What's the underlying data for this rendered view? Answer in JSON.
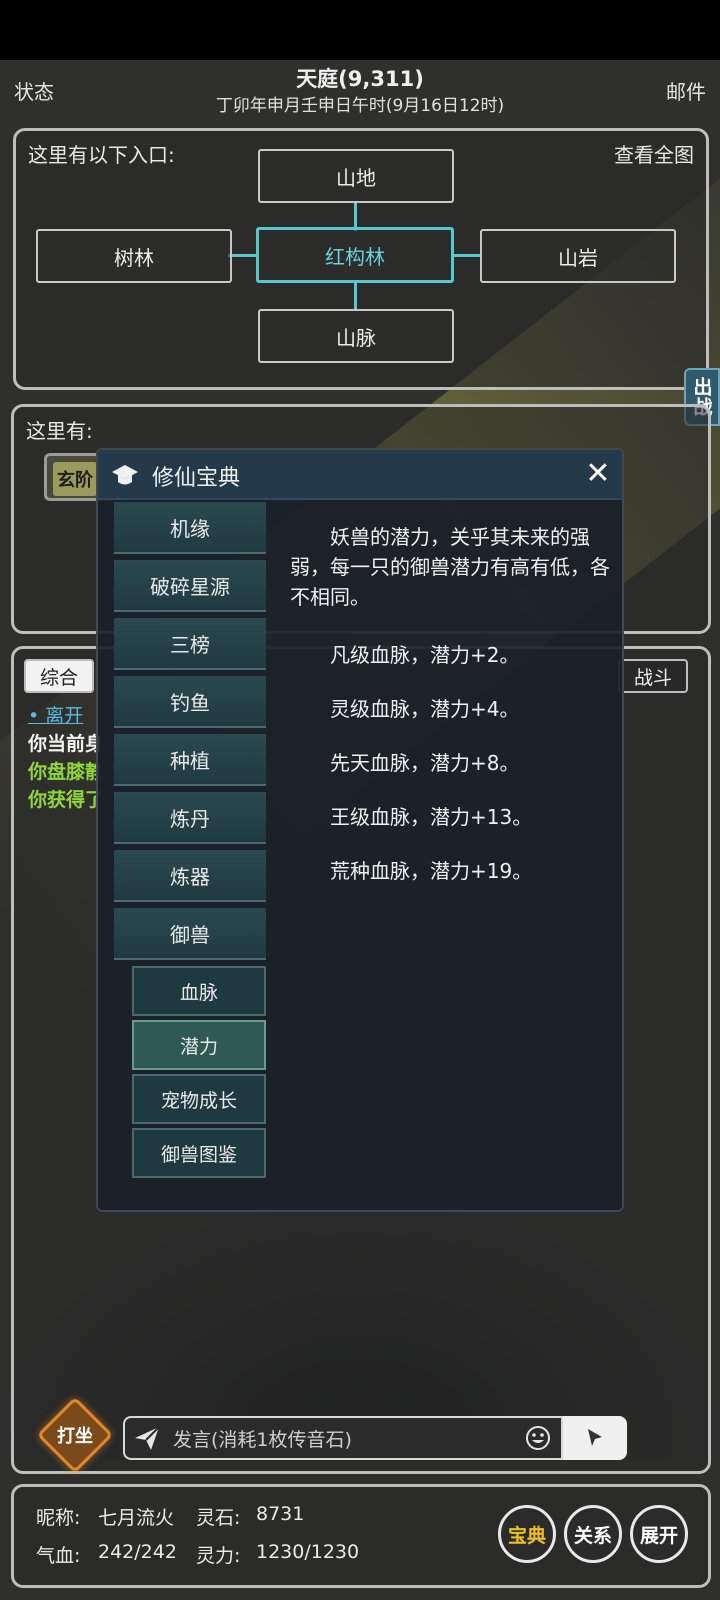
{
  "header": {
    "left": "状态",
    "title": "天庭(9,311)",
    "subtitle": "丁卯年申月壬申日午时(9月16日12时)",
    "right": "邮件"
  },
  "map": {
    "label": "这里有以下入口:",
    "view_all": "查看全图",
    "nodes": {
      "north": "山地",
      "west": "树林",
      "center": "红构林",
      "east": "山岩",
      "south": "山脉"
    }
  },
  "here": {
    "label": "这里有:",
    "npc_chip": "玄阶"
  },
  "side_tab": "出战",
  "log": {
    "tabs": {
      "general": "综合",
      "battle": "战斗"
    },
    "lines": [
      "• 离开",
      "你当前身",
      "你盘膝静",
      "你获得了"
    ]
  },
  "chat": {
    "zazen": "打坐",
    "placeholder": "发言(消耗1枚传音石)"
  },
  "player": {
    "nickname_label": "昵称:",
    "nickname": "七月流火",
    "spirit_stone_label": "灵石:",
    "spirit_stone": "8731",
    "hp_label": "气血:",
    "hp": "242/242",
    "mana_label": "灵力:",
    "mana": "1230/1230"
  },
  "buttons": {
    "codex": "宝典",
    "relations": "关系",
    "expand": "展开"
  },
  "modal": {
    "title": "修仙宝典",
    "menu": [
      "机缘",
      "破碎星源",
      "三榜",
      "钓鱼",
      "种植",
      "炼丹",
      "炼器",
      "御兽"
    ],
    "submenu": [
      "血脉",
      "潜力",
      "宠物成长",
      "御兽图鉴"
    ],
    "active_submenu": "潜力",
    "intro": "妖兽的潜力，关乎其未来的强弱，每一只的御兽潜力有高有低，各不相同。",
    "rows": [
      "凡级血脉，潜力+2。",
      "灵级血脉，潜力+4。",
      "先天血脉，潜力+8。",
      "王级血脉，潜力+13。",
      "荒种血脉，潜力+19。"
    ]
  },
  "colors": {
    "accent": "#56c8d0",
    "codex_gold": "#f0c020",
    "log_green": "#8fd63a"
  }
}
